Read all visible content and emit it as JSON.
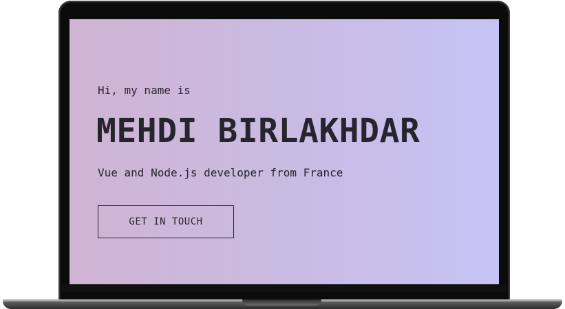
{
  "hero": {
    "intro": "Hi, my name is",
    "name": "MEHDI BIRLAKHDAR",
    "tagline": "Vue and Node.js developer from France",
    "cta_label": "GET IN TOUCH"
  },
  "colors": {
    "gradient_start": "#d0b4d3",
    "gradient_end": "#c6c3f5",
    "text": "#26252e",
    "bezel": "#0b0b0c"
  }
}
